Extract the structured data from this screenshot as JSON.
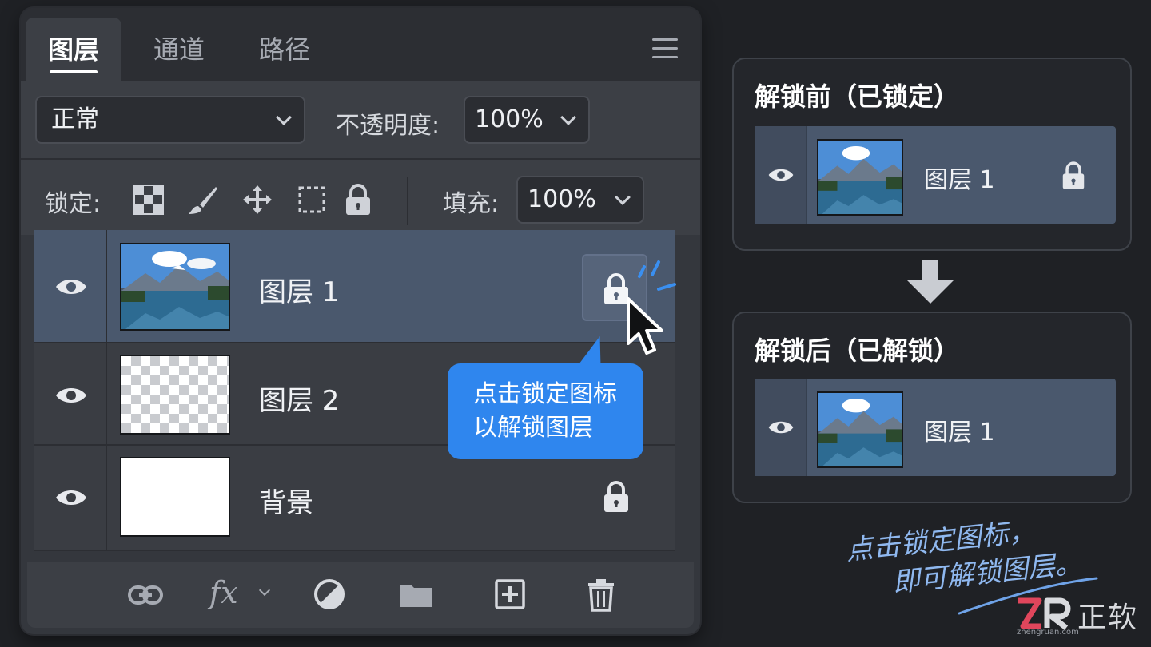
{
  "panel": {
    "tabs": [
      {
        "label": "图层",
        "active": true
      },
      {
        "label": "通道",
        "active": false
      },
      {
        "label": "路径",
        "active": false
      }
    ],
    "blend_mode": "正常",
    "opacity_label": "不透明度:",
    "opacity_value": "100%",
    "lock_label": "锁定:",
    "lock_tools": [
      "checkerboard-icon",
      "brush-icon",
      "move-icon",
      "artboard-icon",
      "lock-icon"
    ],
    "fill_label": "填充:",
    "fill_value": "100%",
    "layers": [
      {
        "name": "图层 1",
        "selected": true,
        "locked": true,
        "thumb": "landscape"
      },
      {
        "name": "图层 2",
        "selected": false,
        "locked": false,
        "thumb": "transparent"
      },
      {
        "name": "背景",
        "selected": false,
        "locked": true,
        "thumb": "white"
      }
    ],
    "bottom_icons": [
      "link-icon",
      "fx-icon",
      "adjustment-icon",
      "folder-icon",
      "new-layer-icon",
      "trash-icon"
    ],
    "fx_label": "fx"
  },
  "tooltip": {
    "line1": "点击锁定图标",
    "line2": "以解锁图层"
  },
  "before_card": {
    "title": "解锁前（已锁定）",
    "layer_name": "图层 1",
    "locked": true
  },
  "after_card": {
    "title": "解锁后（已解锁）",
    "layer_name": "图层 1",
    "locked": false
  },
  "note": {
    "line1": "点击锁定图标，",
    "line2": "即可解锁图层。"
  },
  "brand": {
    "name": "正软",
    "url": "zhengruan.com"
  },
  "colors": {
    "accent": "#2f86ee",
    "selected_row": "#4a586d",
    "panel_bg": "#34373d",
    "page_bg": "#1f2125"
  }
}
